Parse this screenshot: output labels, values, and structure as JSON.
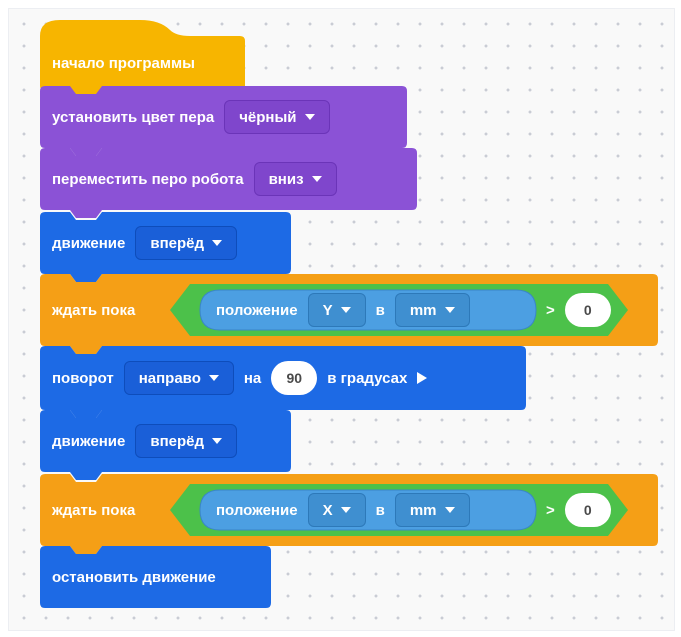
{
  "blocks": {
    "start": {
      "label": "начало программы"
    },
    "pen_color": {
      "label": "установить цвет пера",
      "value": "чёрный"
    },
    "pen_move": {
      "label": "переместить перо робота",
      "value": "вниз"
    },
    "move1": {
      "label": "движение",
      "value": "вперёд"
    },
    "wait1": {
      "label": "ждать пока",
      "sensor": "положение",
      "axis": "Y",
      "in": "в",
      "unit": "mm",
      "op": ">",
      "value": "0"
    },
    "turn": {
      "label": "поворот",
      "direction": "направо",
      "on": "на",
      "degrees": "90",
      "suffix": "в градусах"
    },
    "move2": {
      "label": "движение",
      "value": "вперёд"
    },
    "wait2": {
      "label": "ждать пока",
      "sensor": "положение",
      "axis": "X",
      "in": "в",
      "unit": "mm",
      "op": ">",
      "value": "0"
    },
    "stop": {
      "label": "остановить движение"
    }
  },
  "colors": {
    "events": "#f7b500",
    "pen": "#8b52d6",
    "motion": "#1d6ae5",
    "control": "#f59f16",
    "sensing": "#4c9fe2",
    "operator": "#4cc14a"
  }
}
